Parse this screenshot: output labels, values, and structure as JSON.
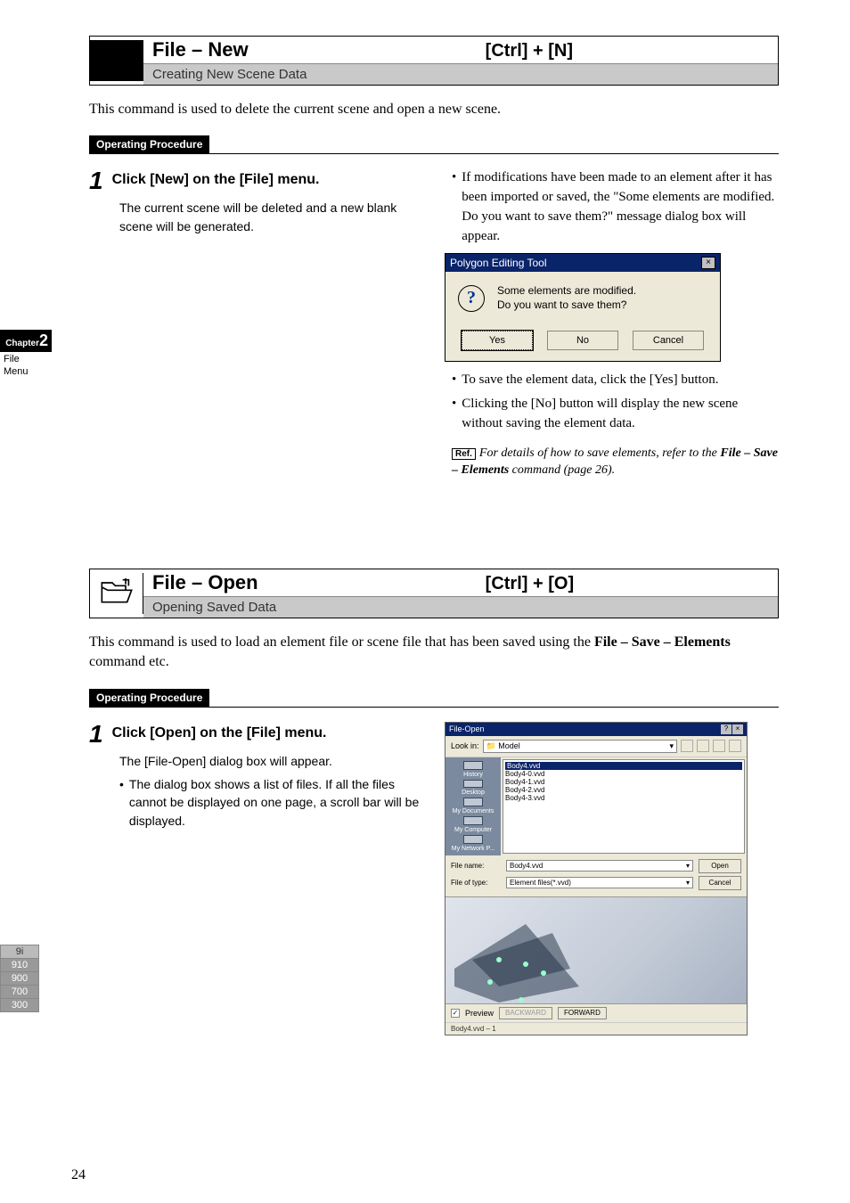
{
  "sideTab": {
    "chapterWord": "Chapter",
    "chapterNum": "2",
    "line1": "File",
    "line2": "Menu"
  },
  "sideBoxes": [
    "9i",
    "910",
    "900",
    "700",
    "300"
  ],
  "section1": {
    "title": "File – New",
    "shortcut": "[Ctrl] + [N]",
    "subtitle": "Creating New Scene Data",
    "desc": "This command is used to delete the current scene and open a new scene.",
    "opLabel": "Operating Procedure",
    "step": {
      "num": "1",
      "title": "Click [New] on the [File] menu.",
      "body": "The current scene will be deleted and a new blank scene will be generated."
    },
    "right": {
      "intro": "If modifications have been made to an element after it has been imported or saved, the \"Some elements are modified. Do you want to save them?\" message dialog box will appear.",
      "dlg": {
        "title": "Polygon Editing Tool",
        "msg1": "Some elements are modified.",
        "msg2": "Do you want to save them?",
        "yes": "Yes",
        "no": "No",
        "cancel": "Cancel"
      },
      "b1": "To save the element data, click the [Yes] button.",
      "b2": "Clicking the [No] button will display the new scene without saving the element data.",
      "refBox": "Ref.",
      "refPre": "For details of how to save elements, refer to the ",
      "refBold": "File – Save – Elements",
      "refPost": " command (page 26)."
    }
  },
  "section2": {
    "title": "File – Open",
    "shortcut": "[Ctrl] + [O]",
    "subtitle": "Opening Saved Data",
    "descPre": "This command is used to load an element file or scene file that has been saved using the ",
    "descBold": "File – Save – Elements",
    "descPost": " command etc.",
    "opLabel": "Operating Procedure",
    "step": {
      "num": "1",
      "title": "Click [Open] on the [File] menu.",
      "body": "The [File-Open] dialog box will appear.",
      "sub": "The dialog box shows a list of files. If all the files cannot be displayed on one page, a scroll bar will be displayed."
    },
    "dlg": {
      "title": "File-Open",
      "lookIn": "Look in:",
      "folder": "Model",
      "files": [
        "Body4.vvd",
        "Body4-0.vvd",
        "Body4-1.vvd",
        "Body4-2.vvd",
        "Body4-3.vvd"
      ],
      "side": [
        "History",
        "Desktop",
        "My Documents",
        "My Computer",
        "My Network P..."
      ],
      "fileNameLbl": "File name:",
      "fileName": "Body4.vvd",
      "fileTypeLbl": "File of type:",
      "fileType": "Element files(*.vvd)",
      "open": "Open",
      "cancel": "Cancel",
      "previewLbl": "Preview",
      "back": "BACKWARD",
      "fwd": "FORWARD",
      "status": "Body4.vvd – 1"
    }
  },
  "pageNum": "24"
}
